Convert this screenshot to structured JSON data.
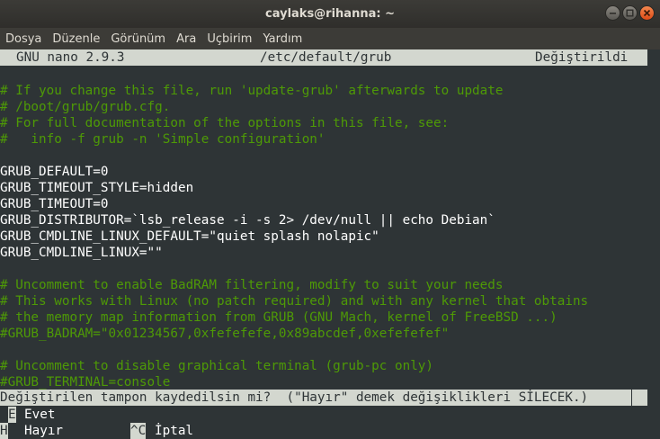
{
  "window": {
    "title": "caylaks@rihanna: ~"
  },
  "menubar": {
    "items": [
      "Dosya",
      "Düzenle",
      "Görünüm",
      "Ara",
      "Uçbirim",
      "Yardım"
    ]
  },
  "nano": {
    "version": "GNU nano 2.9.3",
    "filename": "/etc/default/grub",
    "status": "Değiştirildi"
  },
  "file_lines": [
    {
      "text": "# If you change this file, run 'update-grub' afterwards to update",
      "kind": "comment"
    },
    {
      "text": "# /boot/grub/grub.cfg.",
      "kind": "comment"
    },
    {
      "text": "# For full documentation of the options in this file, see:",
      "kind": "comment"
    },
    {
      "text": "#   info -f grub -n 'Simple configuration'",
      "kind": "comment"
    },
    {
      "text": "",
      "kind": "blank"
    },
    {
      "text": "GRUB_DEFAULT=0",
      "kind": "code"
    },
    {
      "text": "GRUB_TIMEOUT_STYLE=hidden",
      "kind": "code"
    },
    {
      "text": "GRUB_TIMEOUT=0",
      "kind": "code"
    },
    {
      "text": "GRUB_DISTRIBUTOR=`lsb_release -i -s 2> /dev/null || echo Debian`",
      "kind": "code"
    },
    {
      "text": "GRUB_CMDLINE_LINUX_DEFAULT=\"quiet splash nolapic\"",
      "kind": "code"
    },
    {
      "text": "GRUB_CMDLINE_LINUX=\"\"",
      "kind": "code"
    },
    {
      "text": "",
      "kind": "blank"
    },
    {
      "text": "# Uncomment to enable BadRAM filtering, modify to suit your needs",
      "kind": "comment"
    },
    {
      "text": "# This works with Linux (no patch required) and with any kernel that obtains",
      "kind": "comment"
    },
    {
      "text": "# the memory map information from GRUB (GNU Mach, kernel of FreeBSD ...)",
      "kind": "comment"
    },
    {
      "text": "#GRUB_BADRAM=\"0x01234567,0xfefefefe,0x89abcdef,0xefefefef\"",
      "kind": "comment"
    },
    {
      "text": "",
      "kind": "blank"
    },
    {
      "text": "# Uncomment to disable graphical terminal (grub-pc only)",
      "kind": "comment"
    },
    {
      "text": "#GRUB_TERMINAL=console",
      "kind": "comment"
    }
  ],
  "prompt": {
    "text": "Değiştirilen tampon kaydedilsin mi?  (\"Hayır\" demek değişiklikleri SİLECEK.)"
  },
  "shortcuts": [
    {
      "key": "E",
      "label": "Evet"
    },
    {
      "key": "H",
      "label": "Hayır"
    },
    {
      "key": "^C",
      "label": "İptal"
    }
  ],
  "colors": {
    "terminal_bg": "#2e3436",
    "comment": "#4e9a06",
    "bar_bg": "#d3d7cf",
    "close_button": "#df4b16"
  }
}
